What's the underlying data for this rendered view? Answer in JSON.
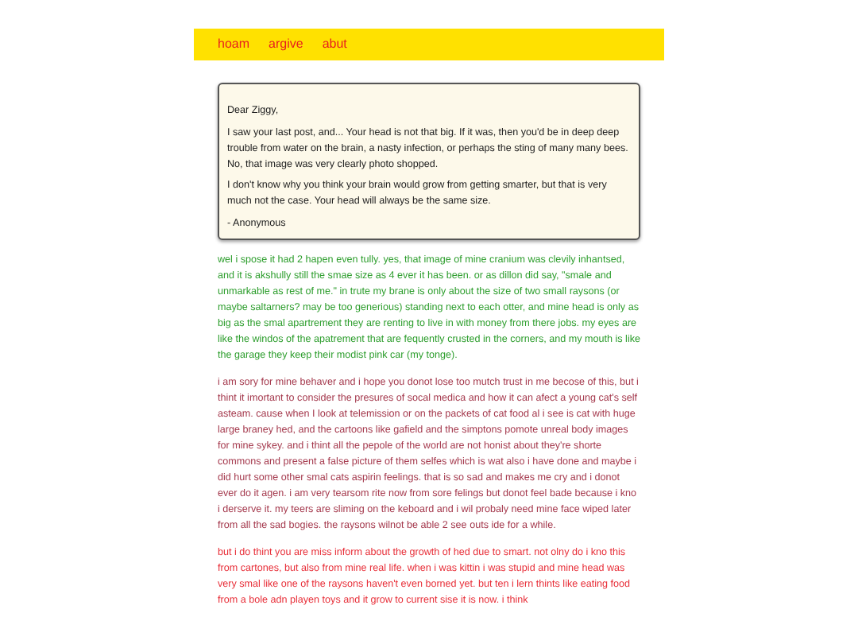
{
  "nav": [
    {
      "label": "hoam"
    },
    {
      "label": "argive"
    },
    {
      "label": "abut"
    }
  ],
  "letter": {
    "salutation": "Dear Ziggy,",
    "paragraphs": [
      "I saw your last post, and... Your head is not that big. If it was, then you'd be in deep deep trouble from water on the brain, a nasty infection, or perhaps the sting of many many bees. No, that image was very clearly photo shopped.",
      "I don't know why you think your brain would grow from getting smarter, but that is very much not the case. Your head will always be the same size."
    ],
    "signature": "- Anonymous"
  },
  "replies": [
    {
      "text": "wel i spose it had 2 hapen even tully. yes, that image of mine cranium was clevily inhantsed, and it is akshully still the smae size as 4 ever it has been. or as dillon did say, \"smale and unmarkable as rest of me.\" in trute my brane is only about the size of two small raysons (or maybe saltarners? may be too generious) standing next to each otter, and mine head is only as big as the smal apartrement they are renting to live in with money from there jobs. my eyes are like the windos of the apatrement that are fequently crusted in the corners, and my mouth is like the garage they keep their modist pink car (my tonge).",
      "color": "#2e9e2e"
    },
    {
      "text": "i am sory for mine behaver and i hope you donot lose too mutch trust in me becose of this, but i thint it imortant to consider the presures of socal medica and how it can afect a young cat's self asteam. cause when I look at telemission or on the packets of cat food al i see is cat with huge large braney hed, and the cartoons like gafield and the simptons pomote unreal body images for mine sykey. and i thint all the pepole of the world are not honist about they're shorte commons and present a false picture of them selfes which is wat also i have done and maybe i did hurt some other smal cats aspirin feelings. that is so sad and makes me cry and i donot ever do it agen. i am very tearsom rite now from sore felings but donot feel bade because i kno i derserve it. my teers are sliming on the keboard and i wil probaly need mine face wiped later from all the sad bogies. the raysons wilnot be able 2 see outs ide for a while.",
      "color": "#a53a4e"
    },
    {
      "text": "but i do thint you are miss inform about the growth of hed due to smart. not olny do i kno this from cartones, but also from mine real life. when i was kittin i was stupid and mine head was very smal like one of the raysons haven't even borned yet. but ten i lern thints like eating food from a bole adn playen toys and it grow to current sise it is now. i think",
      "color": "#e8303a"
    }
  ]
}
